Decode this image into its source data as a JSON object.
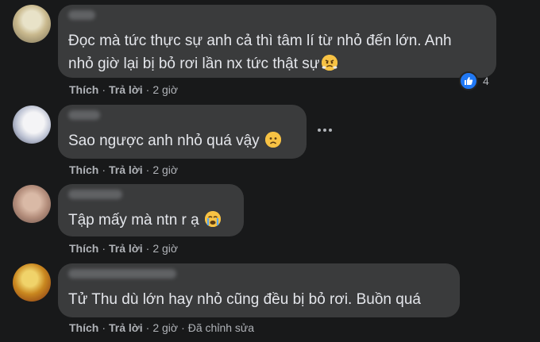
{
  "colors": {
    "background": "#18191a",
    "bubble": "#3a3b3c",
    "text": "#e4e6eb",
    "muted": "#b0b3b8",
    "like": "#2078f4"
  },
  "comments": [
    {
      "lines": [
        "Đọc mà tức thực sự anh cả thì tâm lí từ nhỏ đến lớn. Anh",
        "nhỏ giờ lại bị bỏ rơi lần nx tức thật sự"
      ],
      "emoji": "huffing-face",
      "like_label": "Thích",
      "reply_label": "Trả lời",
      "time": "2 giờ",
      "reactions": {
        "icon": "like-icon",
        "count": "4"
      }
    },
    {
      "lines": [
        "Sao ngược anh nhỏ quá vậy"
      ],
      "emoji": "frowning-face",
      "like_label": "Thích",
      "reply_label": "Trả lời",
      "time": "2 giờ"
    },
    {
      "lines": [
        "Tập mấy mà ntn r ạ"
      ],
      "emoji": "crying-face",
      "like_label": "Thích",
      "reply_label": "Trả lời",
      "time": "2 giờ"
    },
    {
      "lines": [
        "Tử Thu dù lớn hay nhỏ cũng đều bị bỏ rơi. Buồn quá"
      ],
      "like_label": "Thích",
      "reply_label": "Trả lời",
      "time": "2 giờ",
      "edited": "Đã chỉnh sửa"
    }
  ]
}
